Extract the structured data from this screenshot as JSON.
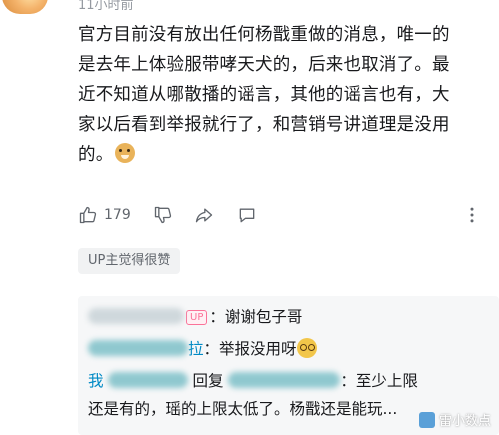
{
  "comment": {
    "timestamp": "11小时前",
    "lines": [
      "官方目前没有放出任何杨戬重做的消息，唯一的",
      "是去年上体验服带哮天犬的，后来也取消了。最",
      "近不知道从哪散播的谣言，其他的谣言也有，大",
      "家以后看到举报就行了，和营销号讲道理是没用",
      "的。"
    ],
    "emoji": "doge-icon",
    "like_count": "179",
    "up_badge": "UP主觉得很赞"
  },
  "replies": {
    "reply1": {
      "up_tag": "UP",
      "text": "：谢谢包子哥"
    },
    "reply2": {
      "suffix": "拉",
      "text": "：举报没用呀"
    },
    "reply3": {
      "prefix": "我",
      "reply_word": "回复",
      "text_line1": "：至少上限",
      "text_line2": "还是有的，瑶的上限太低了。杨戬还是能玩..."
    }
  },
  "watermark": {
    "text": "雷小数点"
  },
  "colors": {
    "accent": "#fb7299",
    "link": "#008ac5",
    "muted": "#9499a0",
    "text": "#18191c"
  }
}
